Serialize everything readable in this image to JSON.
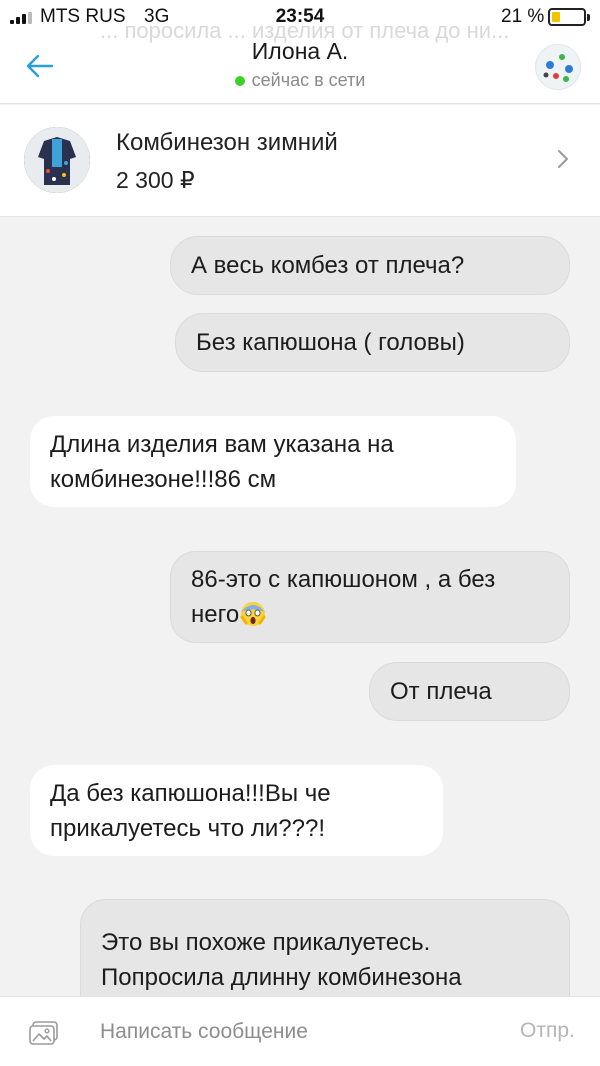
{
  "status_bar": {
    "carrier": "MTS RUS",
    "network": "3G",
    "time": "23:54",
    "battery_percent": "21 %",
    "battery_level": 0.21
  },
  "header": {
    "ghost_text": "... поросила ... изделия от плеча до ни...",
    "title": "Илона А.",
    "online_status": "сейчас в сети",
    "back_icon": "arrow-left-icon",
    "avatar_icon": "avatar"
  },
  "product": {
    "title": "Комбинезон зимний",
    "price": "2 300 ₽"
  },
  "messages": [
    {
      "direction": "out",
      "text": "А весь комбез от плеча?"
    },
    {
      "direction": "out",
      "text": "Без капюшона ( головы)"
    },
    {
      "direction": "in",
      "lines": [
        "Длина изделия вам указана на",
        "комбинезоне!!!86 см"
      ]
    },
    {
      "direction": "out",
      "lines": [
        "86-это с капюшоном , а без",
        "него"
      ],
      "emoji": "face-screaming-in-fear"
    },
    {
      "direction": "out",
      "text": "От плеча"
    },
    {
      "direction": "in",
      "lines": [
        "Да без капюшона!!!Вы че",
        "прикалуетесь что ли???!"
      ]
    },
    {
      "direction": "out",
      "lines": [
        "Это вы похоже прикалуетесь.",
        "Попросила длинну комбинезона"
      ]
    }
  ],
  "composer": {
    "placeholder": "Написать сообщение",
    "send_label": "Отпр.",
    "attach_icon": "image-attach-icon"
  },
  "colors": {
    "accent": "#2a9fd8",
    "online": "#3ecf2b",
    "outgoing_bubble": "#e6e6e6",
    "incoming_bubble": "#ffffff",
    "background": "#f2f2f2"
  }
}
